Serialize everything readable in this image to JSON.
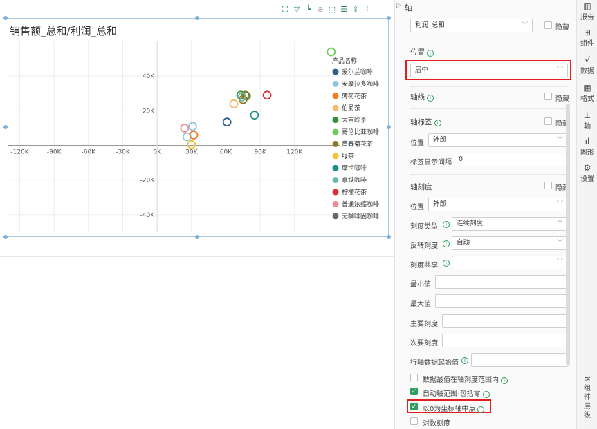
{
  "chart_data": {
    "type": "scatter",
    "title": "销售额_总和/利润_总和",
    "xlim": [
      -130000,
      160000
    ],
    "ylim": [
      -50000,
      60000
    ],
    "x_ticks": [
      -120000,
      -90000,
      -60000,
      -30000,
      0,
      30000,
      60000,
      90000,
      120000
    ],
    "x_tick_labels": [
      "-120K",
      "-90K",
      "-60K",
      "-30K",
      "0K",
      "30K",
      "60K",
      "90K",
      "120K"
    ],
    "y_ticks": [
      -40000,
      -20000,
      20000,
      40000
    ],
    "y_tick_labels": [
      "-40K",
      "-20K",
      "20K",
      "40K"
    ],
    "grid": true,
    "legend_title": "产品名称",
    "legend_position": "right",
    "series": [
      {
        "name": "爱尔兰咖啡",
        "color": "#2f5f8a",
        "points": [
          [
            61000,
            13500
          ]
        ]
      },
      {
        "name": "安摩拉多咖啡",
        "color": "#8fc1e3",
        "points": [
          [
            26000,
            5000
          ],
          [
            31000,
            11000
          ]
        ]
      },
      {
        "name": "薄荷花茶",
        "color": "#f07d22",
        "points": [
          [
            32000,
            6000
          ]
        ]
      },
      {
        "name": "伯爵茶",
        "color": "#f6b96d",
        "points": [
          [
            67000,
            24000
          ]
        ]
      },
      {
        "name": "大吉岭茶",
        "color": "#2f8f3a",
        "points": [
          [
            73000,
            29000
          ],
          [
            78000,
            28500
          ]
        ]
      },
      {
        "name": "哥伦比亚咖啡",
        "color": "#6ccc5a",
        "points": [
          [
            152000,
            54000
          ]
        ]
      },
      {
        "name": "黄春菊花茶",
        "color": "#8c7a1f",
        "points": [
          [
            75000,
            26500
          ],
          [
            77000,
            29000
          ]
        ]
      },
      {
        "name": "绿茶",
        "color": "#f4c23b",
        "points": [
          [
            30000,
            500
          ]
        ]
      },
      {
        "name": "摩卡咖啡",
        "color": "#1f8f87",
        "points": [
          [
            85000,
            17500
          ]
        ]
      },
      {
        "name": "拿铁咖啡",
        "color": "#6cb7ad",
        "points": [
          [
            74000,
            28000
          ]
        ]
      },
      {
        "name": "柠檬花茶",
        "color": "#d6303f",
        "points": [
          [
            96000,
            29000
          ]
        ]
      },
      {
        "name": "普通浓缩咖啡",
        "color": "#f08c98",
        "points": [
          [
            24000,
            10000
          ]
        ]
      },
      {
        "name": "无咖啡因咖啡",
        "color": "#6f6260",
        "points": []
      }
    ]
  },
  "toolbar_icons": [
    "expand-icon",
    "filter-icon",
    "drill-icon",
    "zoom-icon",
    "select-icon",
    "list-icon",
    "export-icon",
    "more-icon"
  ],
  "panel": {
    "header": "轴",
    "axis_select": "利润_总和",
    "hide_label": "隐藏",
    "position_label": "位置",
    "position_value": "居中",
    "axis_line_label": "轴线",
    "axis_line_hide": "隐藏",
    "axis_tick_label_label": "轴标签",
    "axis_tick_label_hide": "隐藏",
    "label_position_label": "位置",
    "label_position_value": "外部",
    "label_interval_label": "标签显示间隔",
    "label_interval_value": "0",
    "axis_scale_label": "轴刻度",
    "axis_scale_hide": "隐藏",
    "scale_position_label": "位置",
    "scale_position_value": "外部",
    "scale_type_label": "刻度类型",
    "scale_type_value": "连续刻度",
    "reverse_label": "反转刻度",
    "reverse_value": "自动",
    "share_label": "刻度共享",
    "share_value": "",
    "min_label": "最小值",
    "max_label": "最大值",
    "major_label": "主要刻度",
    "minor_label": "次要刻度",
    "row_start_label": "行轴数据起始值",
    "opt_range_label": "数据最值在轴刻度范围内",
    "opt_auto_label": "自动轴范围-包括零",
    "opt_center_label": "以0为坐标轴中点",
    "opt_log_label": "对数刻度"
  },
  "side_tabs": [
    {
      "label": "报告",
      "icon": "report-icon"
    },
    {
      "label": "组件",
      "icon": "component-icon"
    },
    {
      "label": "数据",
      "icon": "data-icon"
    },
    {
      "label": "格式",
      "icon": "format-icon"
    },
    {
      "label": "轴",
      "icon": "axis-icon"
    },
    {
      "label": "图形",
      "icon": "graph-icon"
    },
    {
      "label": "设置",
      "icon": "settings-icon"
    },
    {
      "label": "组件层级",
      "icon": "layers-icon"
    }
  ]
}
